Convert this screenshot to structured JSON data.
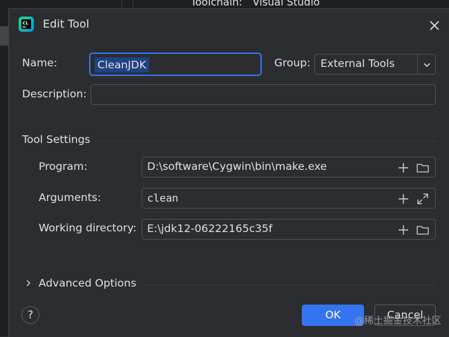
{
  "background": {
    "toolchain_label": "Toolchain:",
    "toolchain_value": "Visual Studio"
  },
  "dialog": {
    "title": "Edit Tool",
    "app_icon": "clion-icon",
    "close_icon": "close-icon"
  },
  "form": {
    "name_label": "Name:",
    "name_value": "CleanJDK",
    "group_label": "Group:",
    "group_value": "External Tools",
    "description_label": "Description:",
    "description_value": ""
  },
  "tool_settings": {
    "title": "Tool Settings",
    "program_label": "Program:",
    "program_value": "D:\\software\\Cygwin\\bin\\make.exe",
    "arguments_label": "Arguments:",
    "arguments_value": "clean",
    "working_dir_label": "Working directory:",
    "working_dir_value": "E:\\jdk12-06222165c35f"
  },
  "advanced": {
    "label": "Advanced Options"
  },
  "footer": {
    "help_label": "?",
    "ok_label": "OK",
    "cancel_label": "Cancel",
    "watermark": "@稀土掘金技术社区"
  },
  "colors": {
    "accent": "#3574f0",
    "background": "#2b2d30",
    "selection": "#214283"
  }
}
